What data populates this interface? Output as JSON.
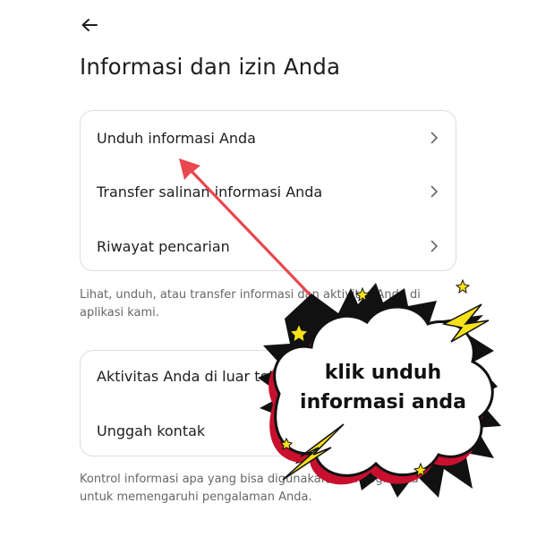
{
  "header": {
    "back_icon": "arrow-left-icon",
    "title": "Informasi dan izin Anda"
  },
  "section1": {
    "items": [
      {
        "label": "Unduh informasi Anda",
        "icon": "chevron-right-icon"
      },
      {
        "label": "Transfer salinan informasi Anda",
        "icon": "chevron-right-icon"
      },
      {
        "label": "Riwayat pencarian",
        "icon": "chevron-right-icon"
      }
    ],
    "helper": "Lihat, unduh, atau transfer informasi dan aktivitas Anda di aplikasi kami."
  },
  "section2": {
    "items": [
      {
        "label": "Aktivitas Anda di luar teknologi Meta",
        "icon": "chevron-right-icon"
      },
      {
        "label": "Unggah kontak",
        "icon": "chevron-right-icon"
      }
    ],
    "helper": "Kontrol informasi apa yang bisa digunakan teknologi Meta untuk memengaruhi pengalaman Anda."
  },
  "annotation": {
    "line1": "klik unduh",
    "line2": "informasi anda",
    "arrow_color": "#e8474f",
    "bubble_shadow_color": "#c8102e",
    "spark_color": "#f5e11a"
  }
}
